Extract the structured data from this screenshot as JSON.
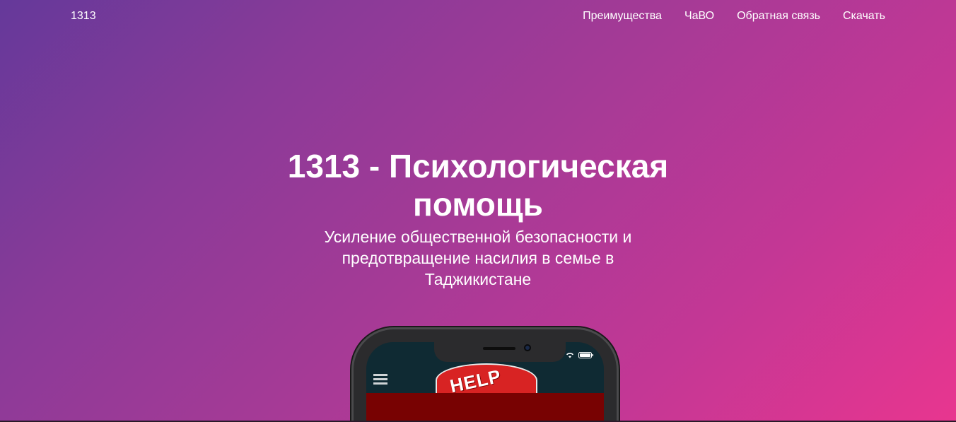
{
  "navbar": {
    "brand": "1313",
    "links": [
      {
        "label": "Преимущества"
      },
      {
        "label": "ЧаВО"
      },
      {
        "label": "Обратная связь"
      },
      {
        "label": "Скачать"
      }
    ]
  },
  "hero": {
    "title": "1313 - Психологическая помощь",
    "subtitle": "Усиление общественной безопасности и предотвращение насилия в семье в Таджикистане"
  },
  "phone": {
    "help_label": "HELP",
    "icons": [
      "menu-icon",
      "signal-icon",
      "wifi-icon",
      "battery-icon"
    ]
  },
  "colors": {
    "gradient_start": "#65399a",
    "gradient_end": "#e8368f",
    "help_red": "#d82323",
    "panel_dark_red": "#780202"
  }
}
